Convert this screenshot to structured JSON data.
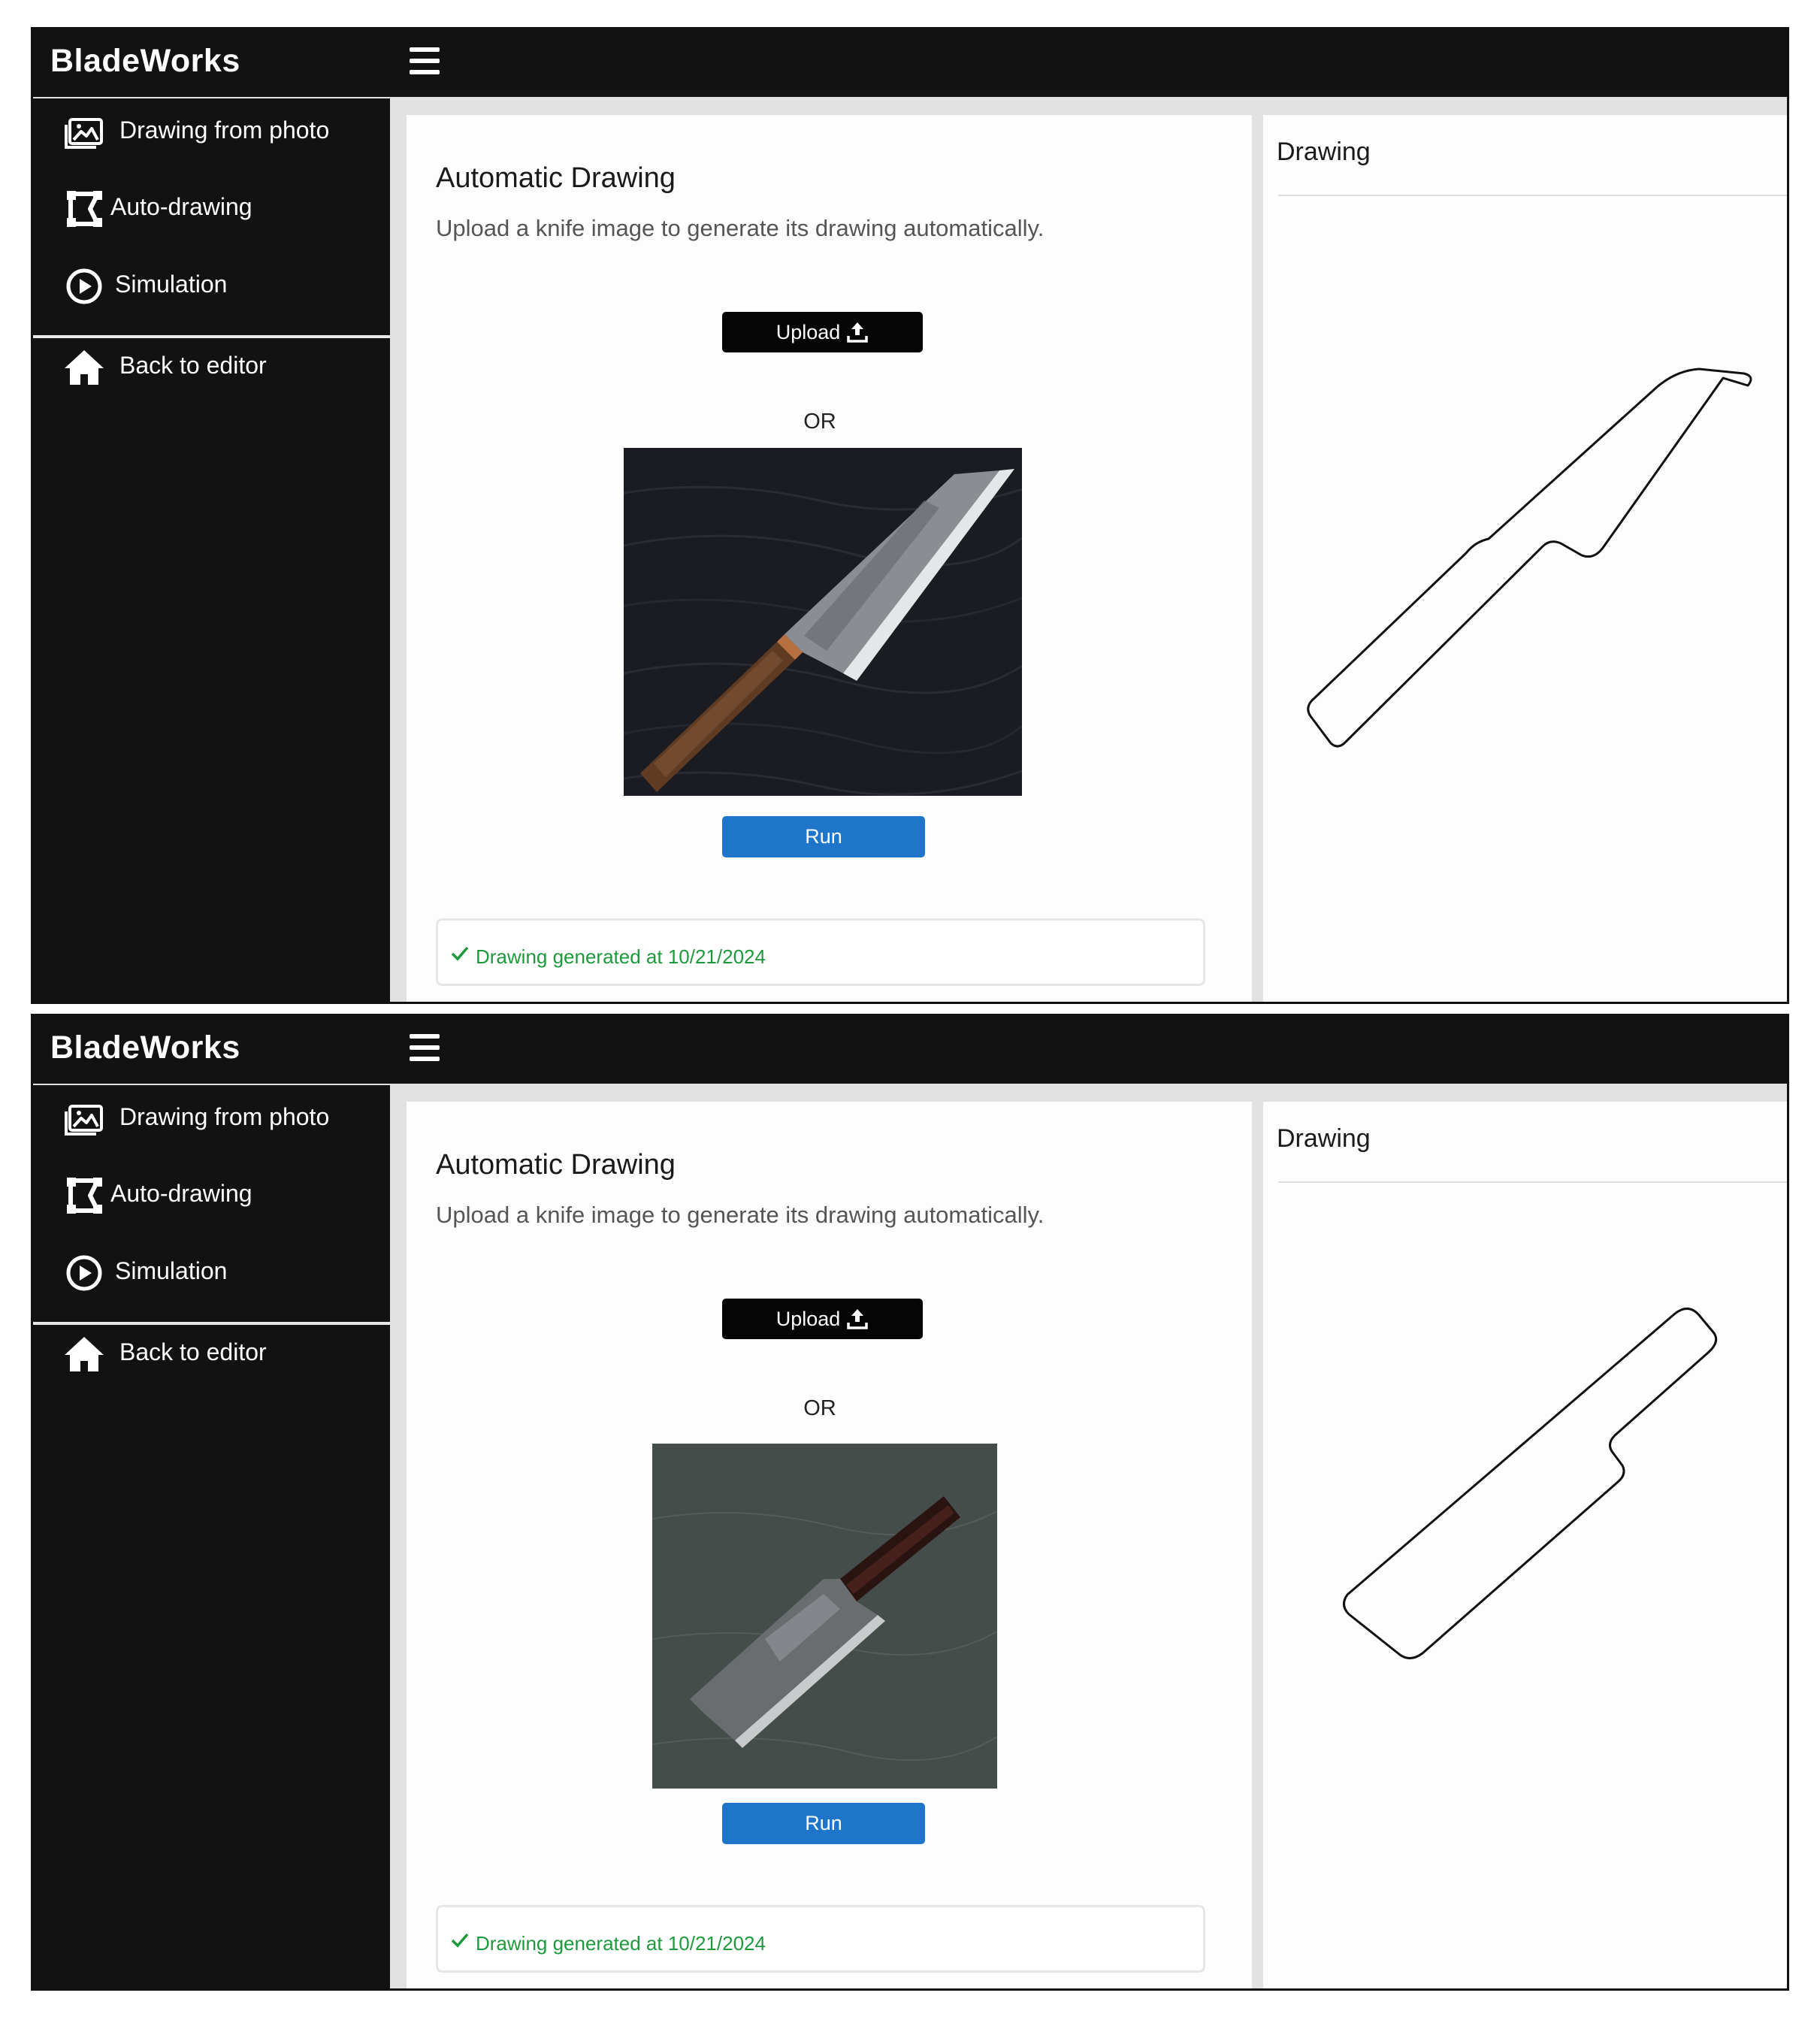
{
  "app": {
    "brand": "BladeWorks"
  },
  "sidebar": {
    "items": [
      {
        "label": "Drawing from photo",
        "icon": "image-icon"
      },
      {
        "label": "Auto-drawing",
        "icon": "auto-draw-icon"
      },
      {
        "label": "Simulation",
        "icon": "play-circle-icon"
      }
    ],
    "back": {
      "label": "Back to editor",
      "icon": "home-icon"
    }
  },
  "main": {
    "title": "Automatic Drawing",
    "subtitle": "Upload a knife image to generate its drawing automatically.",
    "upload_label": "Upload",
    "upload_icon": "upload-icon",
    "or_label": "OR",
    "run_label": "Run",
    "status_text": "Drawing generated at 10/21/2024"
  },
  "drawing_panel": {
    "title": "Drawing"
  },
  "screens": [
    {
      "photo_subject": "gyuto-style knife on dark wood grain",
      "photo_bg": "#1b1c22"
    },
    {
      "photo_subject": "nakiri-style knife on grey textured surface",
      "photo_bg": "#4a5250"
    }
  ],
  "colors": {
    "sidebar_bg": "#121212",
    "run_button": "#1f75c9",
    "upload_button": "#050505",
    "status_success": "#1d9a3c",
    "page_bg": "#e1e1e1"
  }
}
